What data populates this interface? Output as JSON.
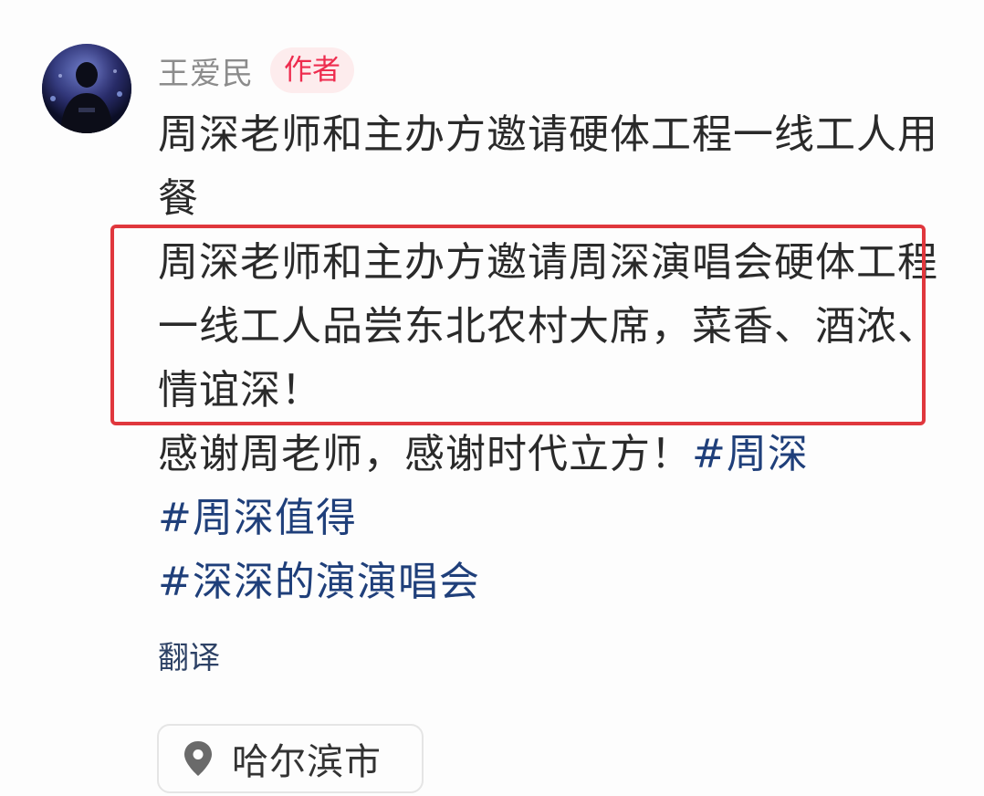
{
  "author": {
    "name": "王爱民",
    "badge": "作者",
    "avatar_icon": "avatar-photo-icon"
  },
  "post": {
    "paragraph_1": "周深老师和主办方邀请硬体工程一线工人用餐",
    "paragraph_2": "周深老师和主办方邀请周深演唱会硬体工程一线工人品尝东北农村大席，菜香、酒浓、情谊深！",
    "paragraph_3_text": "感谢周老师，感谢时代立方！",
    "hashtags": [
      "#周深",
      "#周深值得",
      "#深深的演演唱会"
    ]
  },
  "translate_label": "翻译",
  "location": {
    "icon": "location-pin-icon",
    "label": "哈尔滨市"
  },
  "colors": {
    "badge_text": "#ee2c4e",
    "badge_bg": "#fdeced",
    "hashtag": "#1f3f7a",
    "highlight_border": "#e0373d"
  }
}
